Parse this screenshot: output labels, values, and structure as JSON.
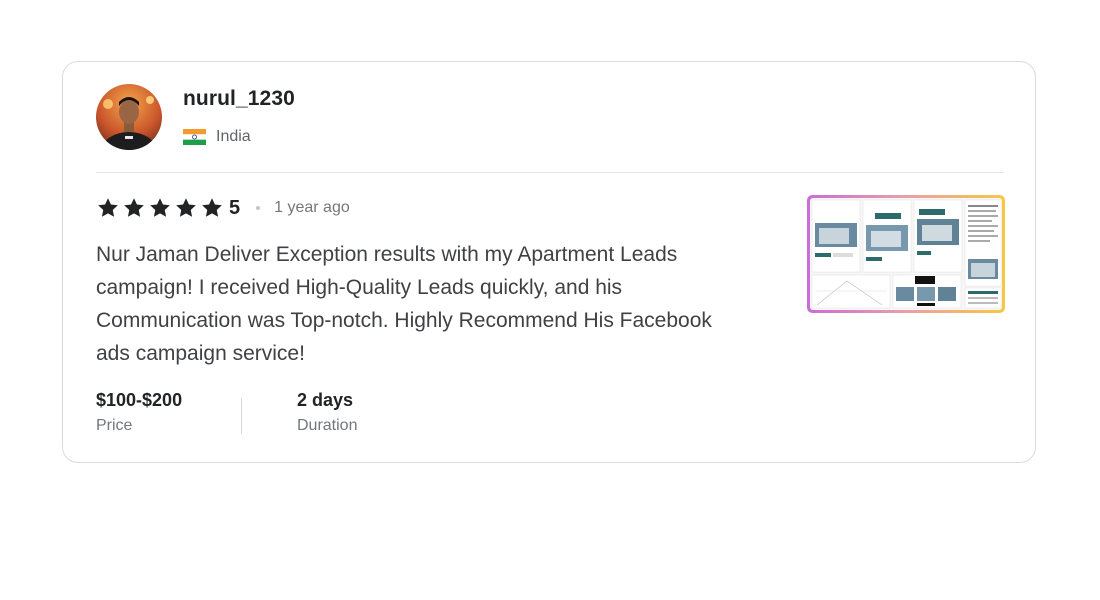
{
  "reviewer": {
    "username": "nurul_1230",
    "country": "India",
    "avatar_icon": "user-avatar",
    "flag_icon": "india-flag-icon"
  },
  "review": {
    "rating": "5",
    "stars": 5,
    "time_ago": "1 year ago",
    "text": "Nur Jaman Deliver Exception results with my Apartment Leads campaign! I received High-Quality Leads quickly, and his Communication was Top-notch. Highly Recommend His Facebook ads campaign service!"
  },
  "meta": {
    "price_value": "$100-$200",
    "price_label": "Price",
    "duration_value": "2 days",
    "duration_label": "Duration"
  },
  "colors": {
    "star": "#222325",
    "text": "#404145",
    "muted": "#74767e",
    "border": "#dadbdd",
    "attachment_gradient_start": "#c86dd7",
    "attachment_gradient_end": "#f5c842"
  }
}
